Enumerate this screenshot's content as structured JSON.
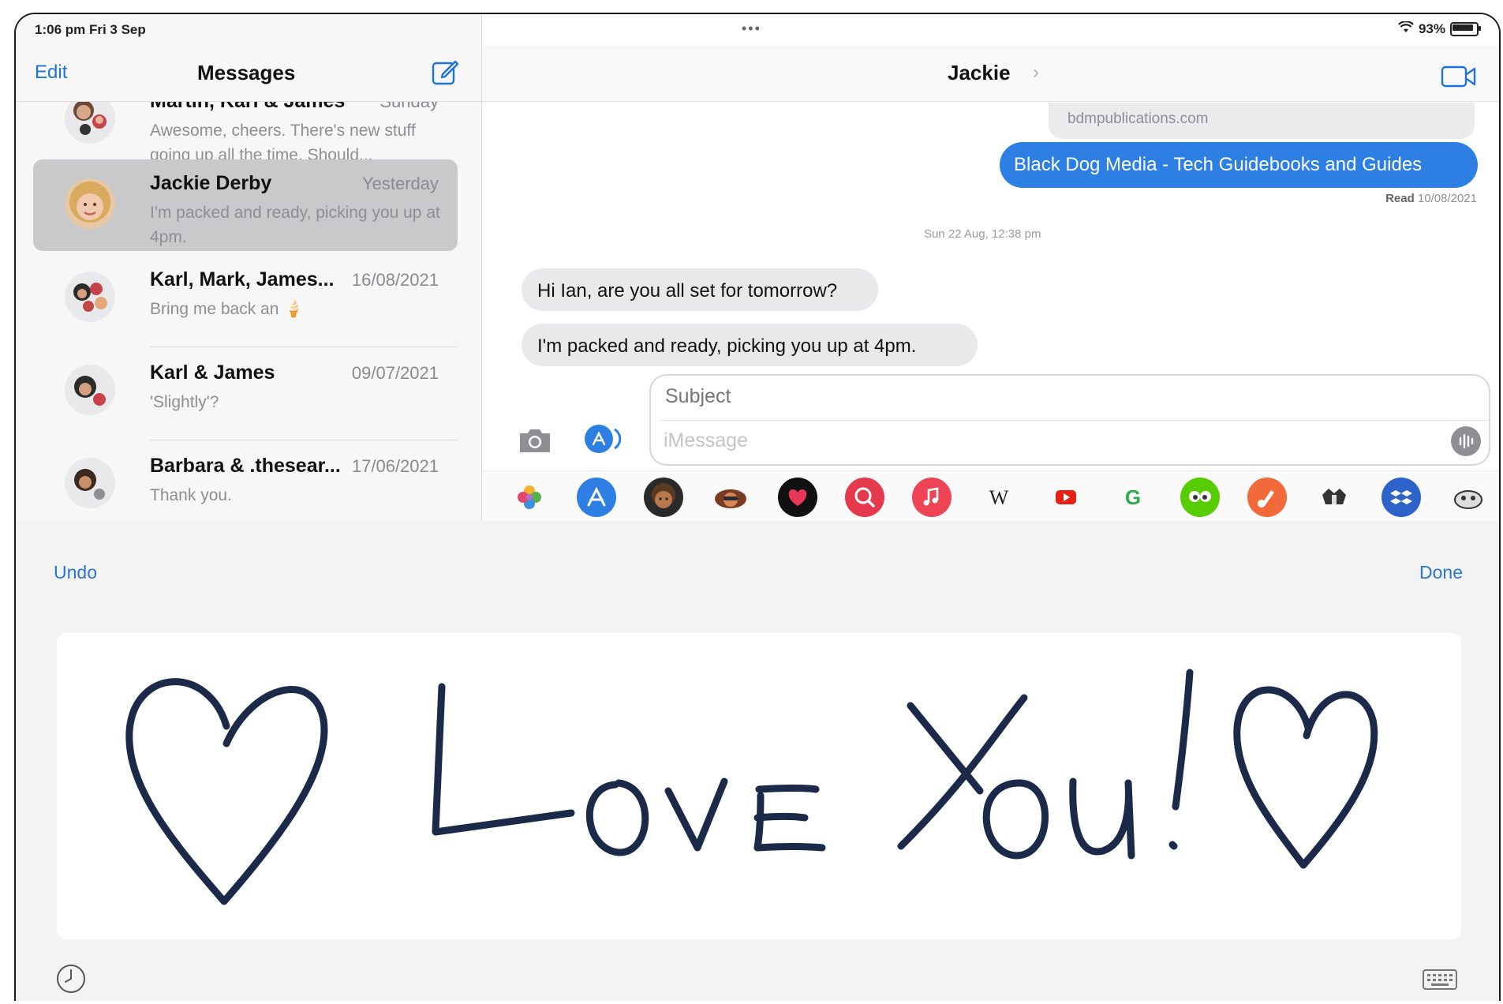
{
  "status_bar": {
    "time": "1:06 pm  Fri 3 Sep",
    "dots": "•••",
    "battery": "93%"
  },
  "sidebar": {
    "edit_label": "Edit",
    "title": "Messages",
    "conversations": [
      {
        "name": "Martin, Karl & James",
        "date": "Sunday",
        "preview": "Awesome, cheers. There's new stuff going up all the time. Should..."
      },
      {
        "name": "Jackie Derby",
        "date": "Yesterday",
        "preview": "I'm packed and ready, picking you up at 4pm."
      },
      {
        "name": "Karl, Mark, James...",
        "date": "16/08/2021",
        "preview": "Bring me back an 🍦"
      },
      {
        "name": "Karl & James",
        "date": "09/07/2021",
        "preview": "'Slightly'?"
      },
      {
        "name": "Barbara & .thesear...",
        "date": "17/06/2021",
        "preview": "Thank you."
      }
    ]
  },
  "conversation": {
    "contact": "Jackie",
    "chevron": "›",
    "link_domain": "bdmpublications.com",
    "link_title": "Black Dog Media - Tech Guidebooks and Guides",
    "read_label": "Read",
    "read_date": "10/08/2021",
    "timestamp": "Sun 22 Aug, 12:38 pm",
    "messages": [
      {
        "from": "contact",
        "text": "Hi Ian, are you all set for tomorrow?"
      },
      {
        "from": "contact",
        "text": "I'm packed and ready, picking you up at 4pm."
      }
    ],
    "subject_placeholder": "Subject",
    "message_placeholder": "iMessage"
  },
  "app_drawer": {
    "apps": [
      "photos-icon",
      "app-store-icon",
      "memoji-icon",
      "memoji-stickers-icon",
      "digital-touch-icon",
      "image-search-icon",
      "music-icon",
      "wikipedia-icon",
      "youtube-icon",
      "google-icon",
      "duolingo-icon",
      "garageband-icon",
      "animoji-icon",
      "dropbox-icon",
      "sticker-icon"
    ],
    "wikipedia_glyph": "W",
    "google_glyph": "G"
  },
  "handwriting": {
    "undo_label": "Undo",
    "done_label": "Done",
    "text": "♡ Love You! ♡",
    "ink_color": "#1c2a4a"
  },
  "colors": {
    "accent": "#2a76d2",
    "bubble_blue": "#2d7fe4",
    "bubble_gray": "#e9e9eb"
  }
}
